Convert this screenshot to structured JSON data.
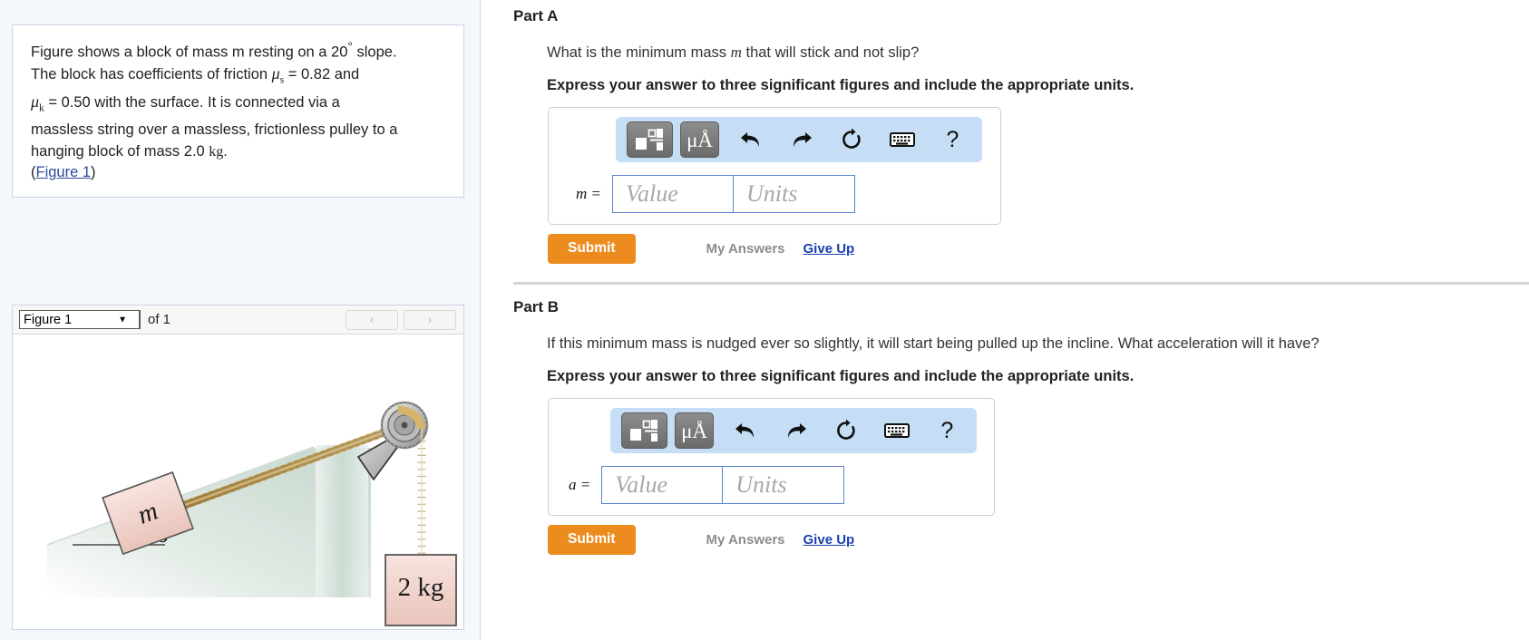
{
  "problem": {
    "line1_a": "Figure shows a block of mass m resting on a 20",
    "line1_deg": "°",
    "line1_b": " slope.",
    "line2_a": "The block has coefficients of friction ",
    "mu_s": "μ",
    "sub_s": "s",
    "line2_b": " = 0.82 and",
    "mu_k": "μ",
    "sub_k": "k",
    "line3_b": " = 0.50 with the surface. It is connected via a",
    "line4": "massless string over a massless, frictionless pulley to a",
    "line5_a": "hanging block of mass 2.0 ",
    "line5_unit": "kg",
    "line5_b": ".",
    "paren_open": "(",
    "figure_link": "Figure 1",
    "paren_close": ")"
  },
  "figure_panel": {
    "select_value": "Figure 1",
    "caret": "▼",
    "of_label": "of 1",
    "prev_label": "‹",
    "next_label": "›",
    "diagram": {
      "block_label": "m",
      "angle_label": "20°",
      "hanging_label": "2 kg"
    }
  },
  "parts": [
    {
      "title": "Part A",
      "question_pre": "What is the minimum mass ",
      "question_var": "m",
      "question_post": " that will stick and not slip?",
      "instruction": "Express your answer to three significant figures and include the appropriate units.",
      "var_label": "m =",
      "value_placeholder": "Value",
      "units_placeholder": "Units",
      "submit_label": "Submit",
      "my_answers_label": "My Answers",
      "give_up_label": "Give Up",
      "toolbar": {
        "template_icon": "template-icon",
        "units_icon": "μÅ",
        "undo_icon": "undo-icon",
        "redo_icon": "redo-icon",
        "reset_icon": "reset-icon",
        "keyboard_icon": "keyboard-icon",
        "help_icon": "?"
      }
    },
    {
      "title": "Part B",
      "question_pre": "If this minimum mass is nudged ever so slightly, it will start being pulled up the incline. What acceleration will it have?",
      "question_var": "",
      "question_post": "",
      "instruction": "Express your answer to three significant figures and include the appropriate units.",
      "var_label": "a =",
      "value_placeholder": "Value",
      "units_placeholder": "Units",
      "submit_label": "Submit",
      "my_answers_label": "My Answers",
      "give_up_label": "Give Up",
      "toolbar": {
        "template_icon": "template-icon",
        "units_icon": "μÅ",
        "undo_icon": "undo-icon",
        "redo_icon": "redo-icon",
        "reset_icon": "reset-icon",
        "keyboard_icon": "keyboard-icon",
        "help_icon": "?"
      }
    }
  ],
  "colors": {
    "accent_orange": "#ec8c1e",
    "link_blue": "#1a3fb0",
    "mathbar_blue": "#c5ddf5",
    "input_border": "#5b84d0",
    "panel_bg": "#f4f8fd"
  }
}
